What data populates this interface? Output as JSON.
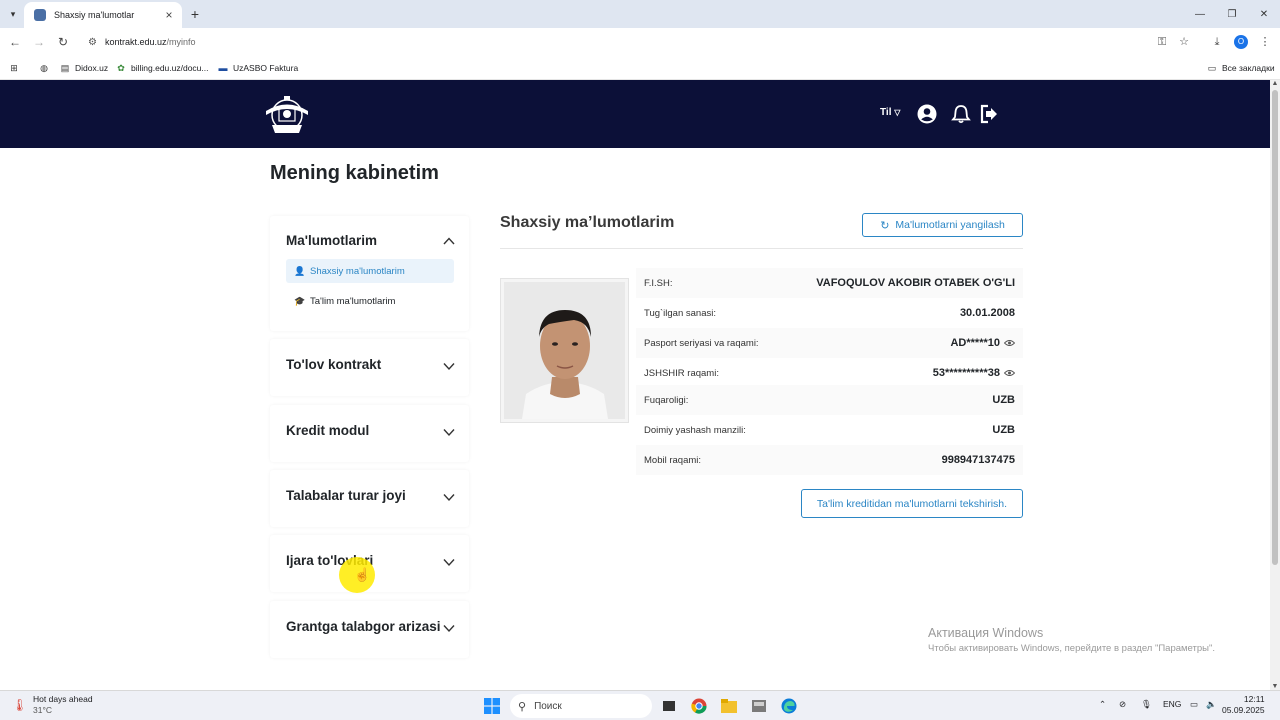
{
  "browser": {
    "tab_title": "Shaxsiy ma'lumotlar",
    "url_host": "kontrakt.edu.uz",
    "url_path": "/myinfo",
    "bookmarks": [
      "Didox.uz",
      "billing.edu.uz/docu...",
      "UzASBO Faktura"
    ],
    "all_bookmarks": "Все закладки",
    "profile_initial": "O"
  },
  "header": {
    "lang": "Til"
  },
  "page": {
    "title": "Mening kabinetim"
  },
  "sidebar": {
    "section1": {
      "title": "Ma'lumotlarim",
      "items": [
        {
          "label": "Shaxsiy ma'lumotlarim",
          "active": true
        },
        {
          "label": "Ta'lim ma'lumotlarim",
          "active": false
        }
      ]
    },
    "sections": [
      {
        "title": "To'lov kontrakt"
      },
      {
        "title": "Kredit modul"
      },
      {
        "title": "Talabalar turar joyi"
      },
      {
        "title": "Ijara to'lovlari"
      },
      {
        "title": "Grantga talabgor arizasi"
      }
    ]
  },
  "content": {
    "title": "Shaxsiy ma’lumotlarim",
    "refresh_button": "Ma'lumotlarni yangilash",
    "rows": [
      {
        "label": "F.I.SH:",
        "value": "VAFOQULOV AKOBIR OTABEK O'G'LI"
      },
      {
        "label": "Tug`ilgan sanasi:",
        "value": "30.01.2008"
      },
      {
        "label": "Pasport seriyasi va raqami:",
        "value": "AD*****10"
      },
      {
        "label": "JSHSHIR raqami:",
        "value": "53**********38"
      },
      {
        "label": "Fuqaroligi:",
        "value": "UZB"
      },
      {
        "label": "Doimiy yashash manzili:",
        "value": "UZB"
      },
      {
        "label": "Mobil raqami:",
        "value": "998947137475"
      }
    ],
    "check_button": "Ta'lim kreditidan ma'lumotlarni tekshirish."
  },
  "watermark": {
    "line1": "Активация Windows",
    "line2": "Чтобы активировать Windows, перейдите в раздел \"Параметры\"."
  },
  "taskbar": {
    "weather_title": "Hot days ahead",
    "weather_temp": "31°C",
    "search_placeholder": "Поиск",
    "lang": "ENG",
    "time": "12:11",
    "date": "05.09.2025"
  },
  "colors": {
    "header_bg": "#0c1038",
    "accent": "#2b86c5",
    "active_item_bg": "#eaf3fb"
  }
}
